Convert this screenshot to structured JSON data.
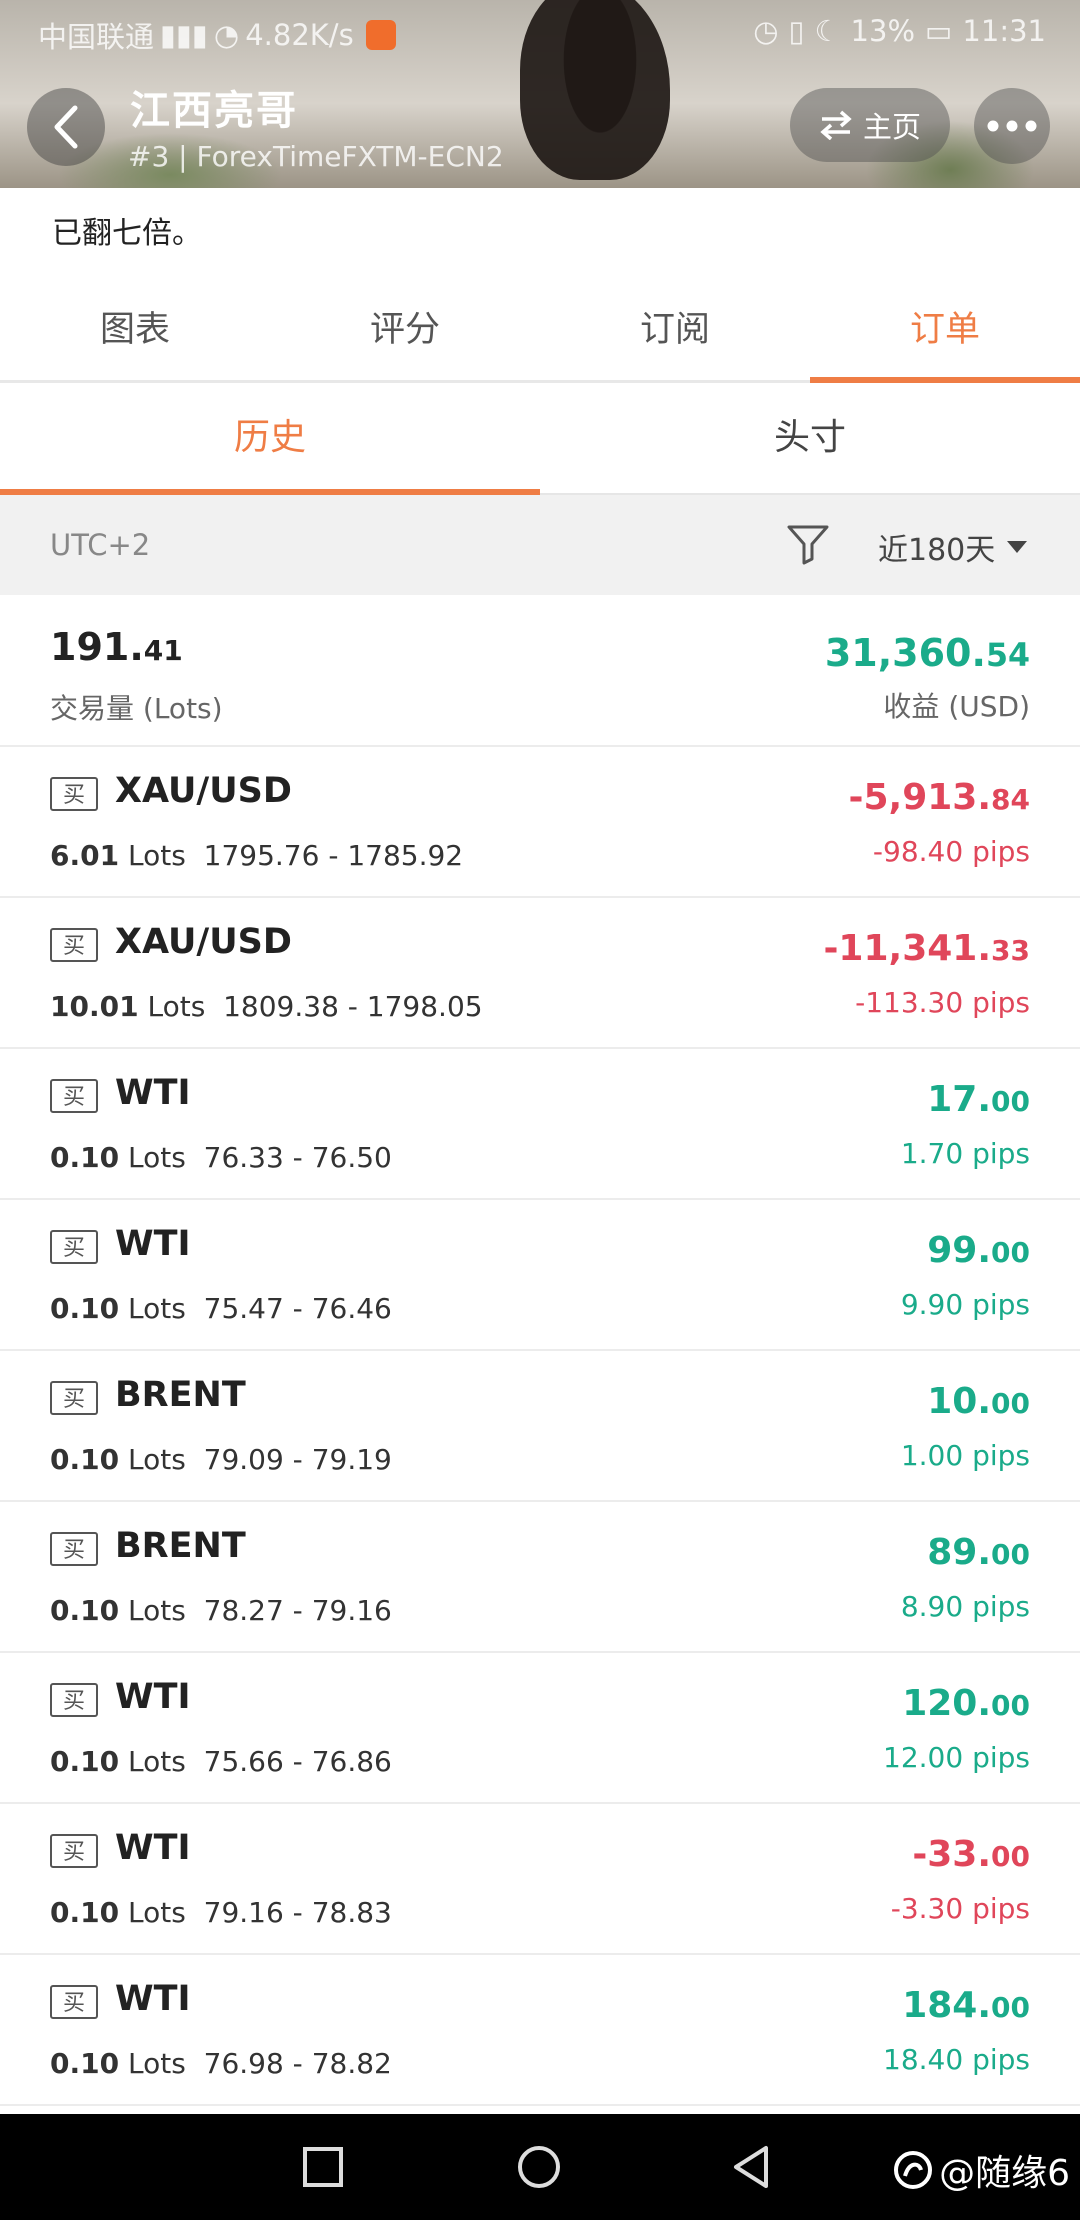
{
  "status_bar": {
    "carrier": "中国联通",
    "speed": "4.82K/s",
    "battery": "13%",
    "time": "11:31"
  },
  "header": {
    "name": "江西亮哥",
    "subtitle": "#3 | ForexTimeFXTM-ECN2",
    "home_label": "主页"
  },
  "description": "已翻七倍。",
  "main_tabs": [
    {
      "label": "图表"
    },
    {
      "label": "评分"
    },
    {
      "label": "订阅"
    },
    {
      "label": "订单"
    }
  ],
  "sub_tabs": [
    {
      "label": "历史"
    },
    {
      "label": "头寸"
    }
  ],
  "filter": {
    "timezone": "UTC+2",
    "range": "近180天"
  },
  "summary": {
    "volume_int": "191.",
    "volume_dec": "41",
    "volume_label": "交易量 (Lots)",
    "profit_int": "31,360.",
    "profit_dec": "54",
    "profit_label": "收益 (USD)"
  },
  "orders": [
    {
      "side": "买",
      "symbol": "XAU/USD",
      "lots": "6.01",
      "unit": "Lots",
      "prices": "1795.76 - 1785.92",
      "amt_int": "-5,913.",
      "amt_dec": "84",
      "pips": "-98.40 pips",
      "tone": "neg"
    },
    {
      "side": "买",
      "symbol": "XAU/USD",
      "lots": "10.01",
      "unit": "Lots",
      "prices": "1809.38 - 1798.05",
      "amt_int": "-11,341.",
      "amt_dec": "33",
      "pips": "-113.30 pips",
      "tone": "neg"
    },
    {
      "side": "买",
      "symbol": "WTI",
      "lots": "0.10",
      "unit": "Lots",
      "prices": "76.33 - 76.50",
      "amt_int": "17.",
      "amt_dec": "00",
      "pips": "1.70 pips",
      "tone": "pos"
    },
    {
      "side": "买",
      "symbol": "WTI",
      "lots": "0.10",
      "unit": "Lots",
      "prices": "75.47 - 76.46",
      "amt_int": "99.",
      "amt_dec": "00",
      "pips": "9.90 pips",
      "tone": "pos"
    },
    {
      "side": "买",
      "symbol": "BRENT",
      "lots": "0.10",
      "unit": "Lots",
      "prices": "79.09 - 79.19",
      "amt_int": "10.",
      "amt_dec": "00",
      "pips": "1.00 pips",
      "tone": "pos"
    },
    {
      "side": "买",
      "symbol": "BRENT",
      "lots": "0.10",
      "unit": "Lots",
      "prices": "78.27 - 79.16",
      "amt_int": "89.",
      "amt_dec": "00",
      "pips": "8.90 pips",
      "tone": "pos"
    },
    {
      "side": "买",
      "symbol": "WTI",
      "lots": "0.10",
      "unit": "Lots",
      "prices": "75.66 - 76.86",
      "amt_int": "120.",
      "amt_dec": "00",
      "pips": "12.00 pips",
      "tone": "pos"
    },
    {
      "side": "买",
      "symbol": "WTI",
      "lots": "0.10",
      "unit": "Lots",
      "prices": "79.16 - 78.83",
      "amt_int": "-33.",
      "amt_dec": "00",
      "pips": "-3.30 pips",
      "tone": "neg"
    },
    {
      "side": "买",
      "symbol": "WTI",
      "lots": "0.10",
      "unit": "Lots",
      "prices": "76.98 - 78.82",
      "amt_int": "184.",
      "amt_dec": "00",
      "pips": "18.40 pips",
      "tone": "pos"
    }
  ],
  "watermark": "@随缘6",
  "colors": {
    "accent": "#ef7d45",
    "profit": "#1aab8a",
    "loss": "#e0465a"
  },
  "icons": {
    "back": "chevron-left-icon",
    "home": "swap-icon",
    "more": "more-horizontal-icon",
    "filter": "filter-icon",
    "nav_recent": "square-icon",
    "nav_home": "circle-icon",
    "nav_back": "triangle-icon"
  }
}
